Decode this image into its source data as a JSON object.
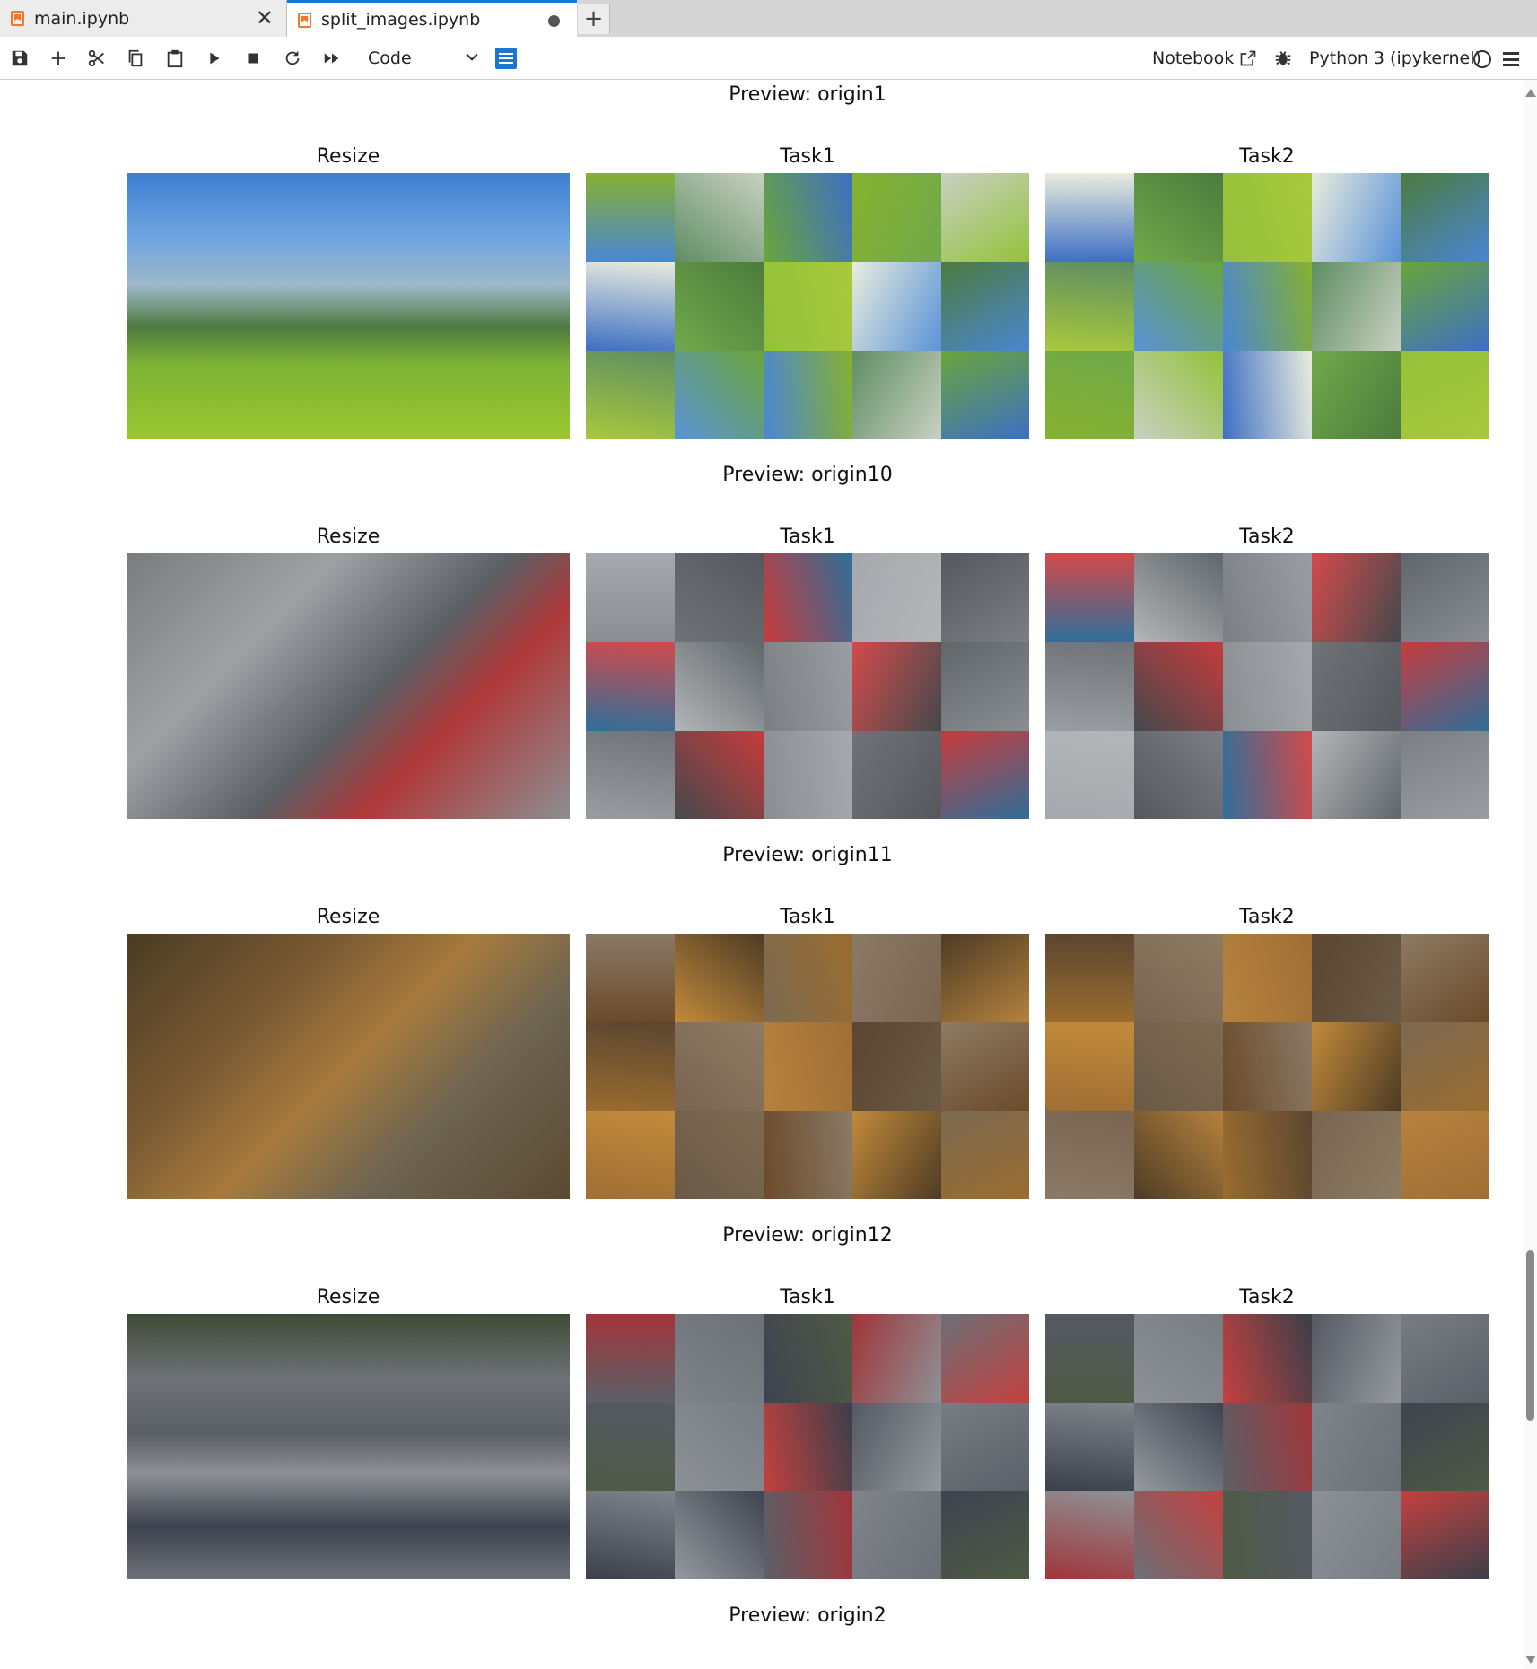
{
  "tabs": [
    {
      "label": "main.ipynb",
      "state": "close"
    },
    {
      "label": "split_images.ipynb",
      "state": "unsaved"
    }
  ],
  "toolbar": {
    "cell_type": "Code",
    "notebook_label": "Notebook",
    "kernel_name": "Python 3 (ipykernel)",
    "accent": "#1976d2"
  },
  "previews": [
    {
      "title": "Preview: origin1",
      "scene": "alpine-meadow",
      "panels": [
        {
          "title": "Resize",
          "kind": "resize"
        },
        {
          "title": "Task1",
          "kind": "task1"
        },
        {
          "title": "Task2",
          "kind": "task2"
        }
      ]
    },
    {
      "title": "Preview: origin10",
      "scene": "scooter-traffic",
      "panels": [
        {
          "title": "Resize",
          "kind": "resize"
        },
        {
          "title": "Task1",
          "kind": "task1"
        },
        {
          "title": "Task2",
          "kind": "task2"
        }
      ]
    },
    {
      "title": "Preview: origin11",
      "scene": "wild-animals",
      "panels": [
        {
          "title": "Resize",
          "kind": "resize"
        },
        {
          "title": "Task1",
          "kind": "task1"
        },
        {
          "title": "Task2",
          "kind": "task2"
        }
      ]
    },
    {
      "title": "Preview: origin12",
      "scene": "car-traffic-jam",
      "panels": [
        {
          "title": "Resize",
          "kind": "resize"
        },
        {
          "title": "Task1",
          "kind": "task1"
        },
        {
          "title": "Task2",
          "kind": "task2"
        }
      ]
    }
  ],
  "next_preview": {
    "title": "Preview: origin2"
  }
}
